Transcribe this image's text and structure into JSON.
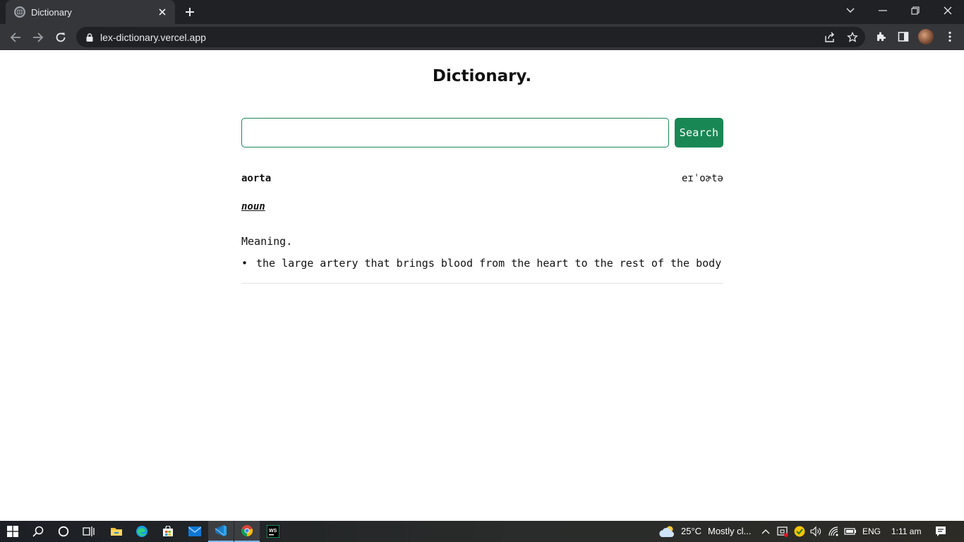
{
  "browser": {
    "tab": {
      "title": "Dictionary",
      "favicon": "globe-icon"
    },
    "url": "lex-dictionary.vercel.app"
  },
  "page": {
    "title": "Dictionary.",
    "search": {
      "value": "",
      "placeholder": "",
      "button_label": "Search"
    },
    "result": {
      "word": "aorta",
      "phonetic": "eɪˈoɚtə",
      "part_of_speech": "noun",
      "meaning_label": "Meaning.",
      "definitions": [
        "the large artery that brings blood from the heart to the rest of the body"
      ]
    }
  },
  "taskbar": {
    "weather": {
      "temp": "25°C",
      "condition": "Mostly cl..."
    },
    "language": "ENG",
    "time": "1:11 am"
  },
  "colors": {
    "accent": "#198754",
    "chrome_dark": "#202124",
    "chrome_mid": "#35363a"
  }
}
